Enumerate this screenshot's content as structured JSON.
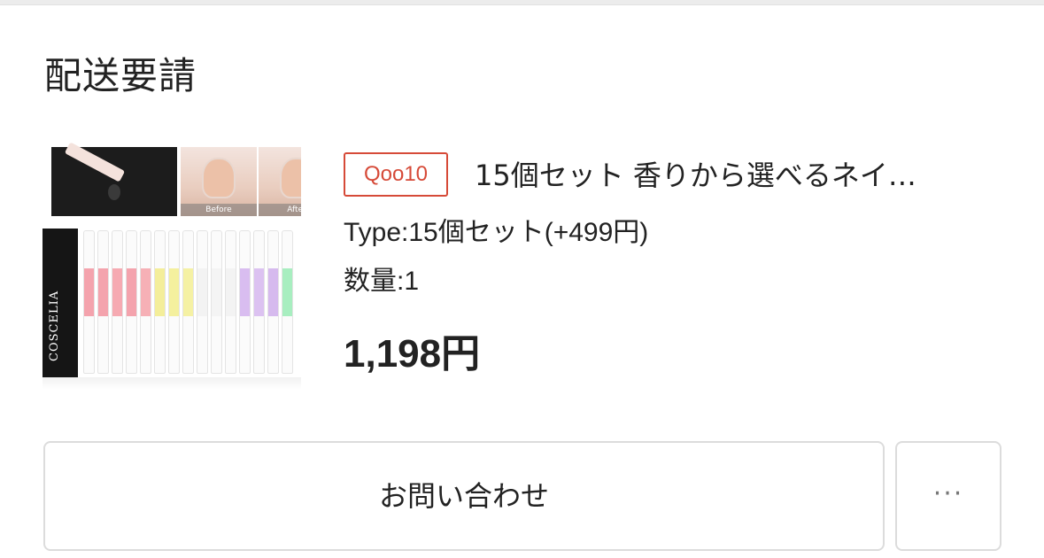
{
  "order": {
    "status_title": "配送要請",
    "product": {
      "seller_badge": "Qoo10",
      "name": "15個セット 香りから選べるネイ…",
      "option": "Type:15個セット(+499円)",
      "quantity": "数量:1",
      "price": "1,198円",
      "image": {
        "before_label": "Before",
        "after_label": "After",
        "brand_text": "COSCELIA"
      }
    },
    "actions": {
      "contact_label": "お問い合わせ",
      "more_label": "···"
    }
  },
  "colors": {
    "badge": "#d64a38",
    "button_border": "#dcdcdc",
    "divider": "#ececec"
  }
}
